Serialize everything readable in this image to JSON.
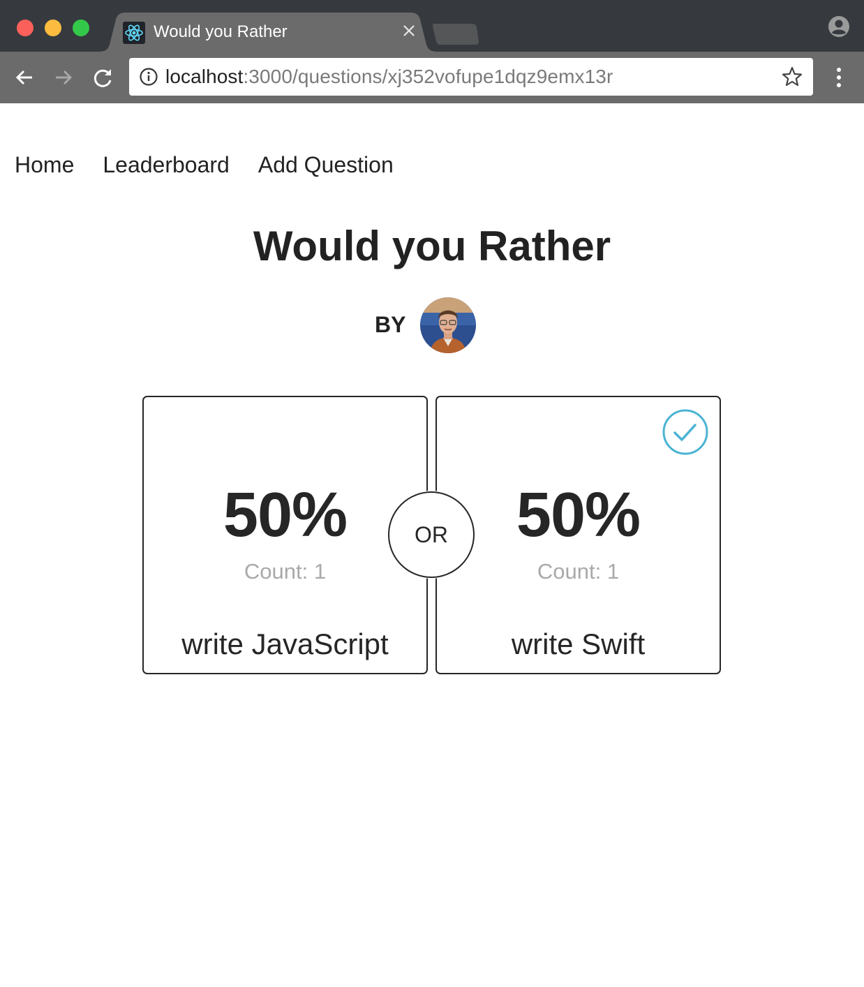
{
  "browser": {
    "tab_title": "Would you Rather",
    "url_host": "localhost",
    "url_path": ":3000/questions/xj352vofupe1dqz9emx13r"
  },
  "nav": {
    "items": [
      {
        "label": "Home"
      },
      {
        "label": "Leaderboard"
      },
      {
        "label": "Add Question"
      }
    ]
  },
  "question": {
    "title": "Would you Rather",
    "by_label": "BY",
    "or_label": "OR",
    "options": [
      {
        "percent": "50%",
        "count_label": "Count: ",
        "count": "1",
        "text": "write JavaScript",
        "voted": false
      },
      {
        "percent": "50%",
        "count_label": "Count: ",
        "count": "1",
        "text": "write Swift",
        "voted": true
      }
    ]
  },
  "colors": {
    "accent_check": "#4ab3d3",
    "text_dark": "#262626",
    "count_gray": "#a9a9a9",
    "titlebar": "#363a3e",
    "toolbar": "#6b6b6b"
  },
  "icons": [
    "react-favicon-icon",
    "close-icon",
    "profile-icon",
    "back-arrow-icon",
    "forward-arrow-icon",
    "reload-icon",
    "info-icon",
    "star-icon",
    "menu-dots-icon",
    "check-circle-icon"
  ]
}
